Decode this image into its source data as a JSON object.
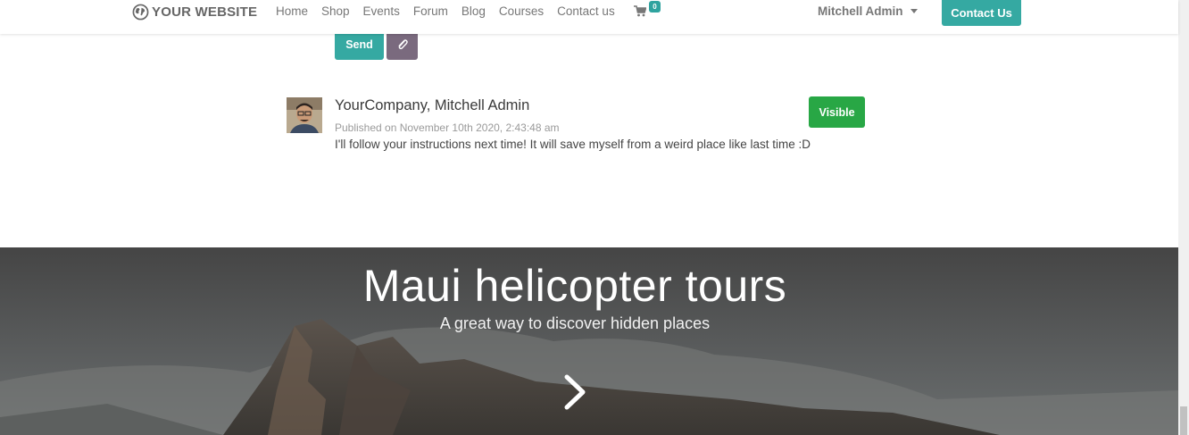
{
  "header": {
    "brand": "YOUR WEBSITE",
    "brand_icon": "globe-icon",
    "nav": [
      "Home",
      "Shop",
      "Events",
      "Forum",
      "Blog",
      "Courses",
      "Contact us"
    ],
    "cart_icon": "shopping-cart-icon",
    "cart_count": "0",
    "user_name": "Mitchell Admin",
    "contact_button": "Contact Us"
  },
  "composer": {
    "send_label": "Send",
    "attach_icon": "paperclip-icon"
  },
  "message": {
    "author": "YourCompany, Mitchell Admin",
    "published": "Published on November 10th 2020, 2:43:48 am",
    "body": "I'll follow your instructions next time! It will save myself from a weird place like last time :D",
    "visibility_button": "Visible"
  },
  "hero": {
    "title": "Maui helicopter tours",
    "subtitle": "A great way to discover hidden places",
    "next_icon": "chevron-right-icon"
  },
  "colors": {
    "primary": "#35a9a2",
    "secondary": "#7a6a7e",
    "success": "#28a745"
  }
}
